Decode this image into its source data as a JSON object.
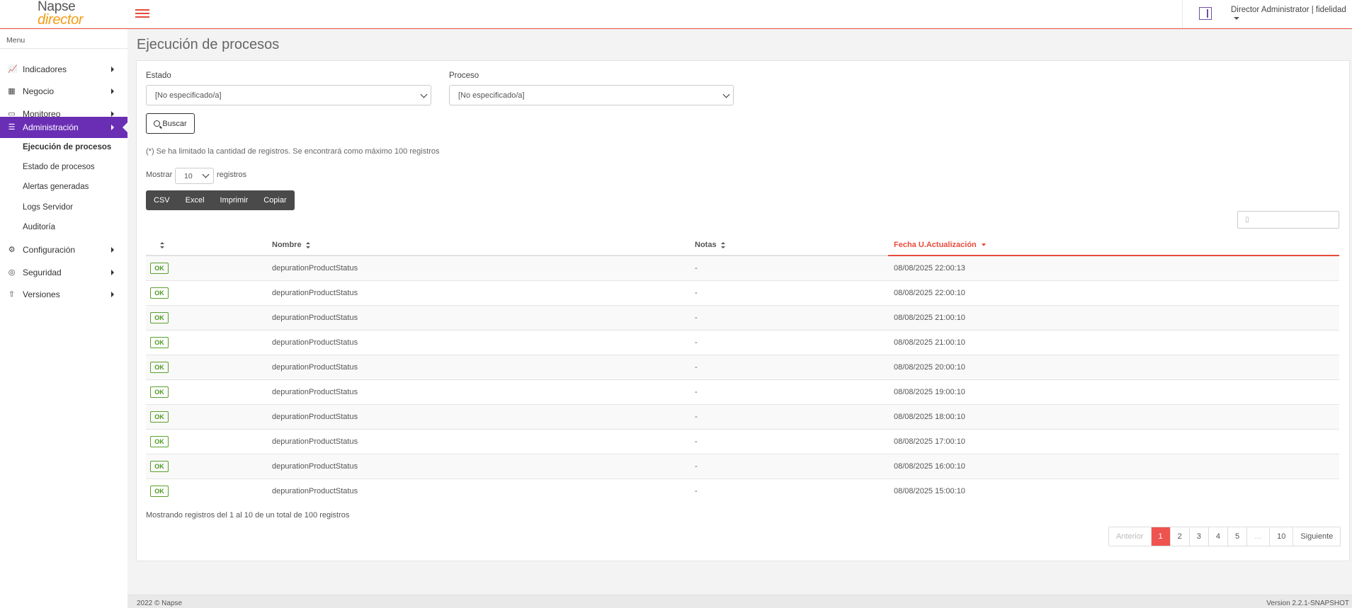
{
  "header": {
    "logo_top": "Napse",
    "logo_bottom": "director",
    "user": "Director Administrator | fidelidad"
  },
  "sidebar": {
    "menu_label": "Menu",
    "items": [
      {
        "label": "Indicadores",
        "icon": "chart-line-icon"
      },
      {
        "label": "Negocio",
        "icon": "building-icon"
      },
      {
        "label": "Monitoreo",
        "icon": "monitor-icon"
      },
      {
        "label": "Administración",
        "icon": "list-check-icon",
        "active": true
      },
      {
        "label": "Configuración",
        "icon": "gears-icon"
      },
      {
        "label": "Seguridad",
        "icon": "shield-icon"
      },
      {
        "label": "Versiones",
        "icon": "upload-icon"
      }
    ],
    "subitems": [
      {
        "label": "Ejecución de procesos",
        "active": true
      },
      {
        "label": "Estado de procesos"
      },
      {
        "label": "Alertas generadas"
      },
      {
        "label": "Logs Servidor"
      },
      {
        "label": "Auditoría"
      }
    ]
  },
  "main": {
    "title": "Ejecución de procesos",
    "filters": {
      "estado_label": "Estado",
      "estado_value": "[No especificado/a]",
      "proceso_label": "Proceso",
      "proceso_value": "[No especificado/a]"
    },
    "search_button": "Buscar",
    "limit_note": "(*) Se ha limitado la cantidad de registros. Se encontrará como máximo 100 registros",
    "show_prefix": "Mostrar",
    "page_length": "10",
    "show_suffix": "registros",
    "export_buttons": [
      "CSV",
      "Excel",
      "Imprimir",
      "Copiar"
    ],
    "table": {
      "headers": [
        "",
        "Nombre",
        "Notas",
        "Fecha U.Actualización"
      ],
      "rows": [
        {
          "status": "OK",
          "nombre": "depurationProductStatus",
          "notas": "-",
          "fecha": "08/08/2025 22:00:13"
        },
        {
          "status": "OK",
          "nombre": "depurationProductStatus",
          "notas": "-",
          "fecha": "08/08/2025 22:00:10"
        },
        {
          "status": "OK",
          "nombre": "depurationProductStatus",
          "notas": "-",
          "fecha": "08/08/2025 21:00:10"
        },
        {
          "status": "OK",
          "nombre": "depurationProductStatus",
          "notas": "-",
          "fecha": "08/08/2025 21:00:10"
        },
        {
          "status": "OK",
          "nombre": "depurationProductStatus",
          "notas": "-",
          "fecha": "08/08/2025 20:00:10"
        },
        {
          "status": "OK",
          "nombre": "depurationProductStatus",
          "notas": "-",
          "fecha": "08/08/2025 19:00:10"
        },
        {
          "status": "OK",
          "nombre": "depurationProductStatus",
          "notas": "-",
          "fecha": "08/08/2025 18:00:10"
        },
        {
          "status": "OK",
          "nombre": "depurationProductStatus",
          "notas": "-",
          "fecha": "08/08/2025 17:00:10"
        },
        {
          "status": "OK",
          "nombre": "depurationProductStatus",
          "notas": "-",
          "fecha": "08/08/2025 16:00:10"
        },
        {
          "status": "OK",
          "nombre": "depurationProductStatus",
          "notas": "-",
          "fecha": "08/08/2025 15:00:10"
        }
      ]
    },
    "info": "Mostrando registros del 1 al 10 de un total de 100 registros",
    "pagination": [
      "Anterior",
      "1",
      "2",
      "3",
      "4",
      "5",
      "…",
      "10",
      "Siguiente"
    ],
    "current_page": "1"
  },
  "footer": {
    "left": "2022 © Napse",
    "right": "Version 2.2.1-SNAPSHOT"
  },
  "colors": {
    "accent": "#e74c3c",
    "sidebar_active": "#6a2eb5",
    "ok_badge": "#4e9a22",
    "logo_orange": "#f39c12"
  }
}
